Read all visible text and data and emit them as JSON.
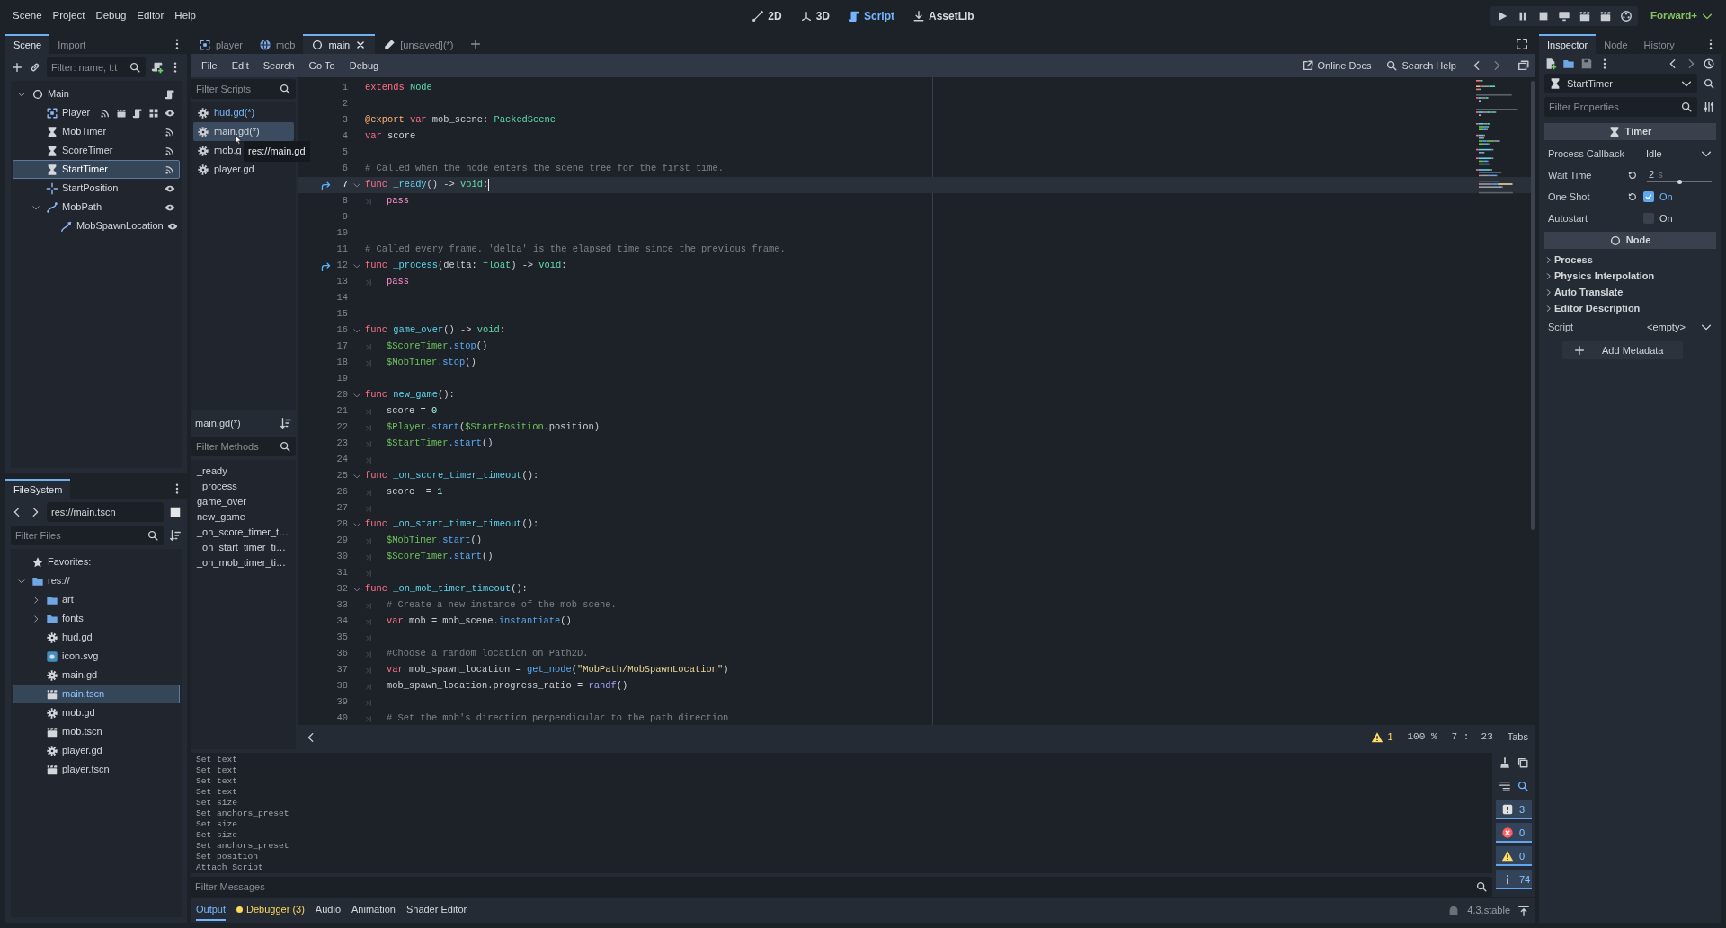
{
  "menu": [
    "Scene",
    "Project",
    "Debug",
    "Editor",
    "Help"
  ],
  "workspaces": [
    {
      "label": "2D",
      "kind": "vector",
      "selected": false
    },
    {
      "label": "3D",
      "kind": "axes",
      "selected": false
    },
    {
      "label": "Script",
      "kind": "script",
      "selected": true
    },
    {
      "label": "AssetLib",
      "kind": "download",
      "selected": false
    }
  ],
  "renderer": "Forward+",
  "scene_dock": {
    "tabs": [
      {
        "label": "Scene",
        "selected": true
      },
      {
        "label": "Import",
        "selected": false
      }
    ],
    "filter": {
      "placeholder": "Filter: name, t:t"
    },
    "tree": [
      {
        "label": "Main",
        "kind": "node",
        "selected": false,
        "expanded": true,
        "indicators": [
          {
            "kind": "script"
          }
        ],
        "children": [
          {
            "label": "Player",
            "kind": "area",
            "selected": false,
            "indicators": [
              {
                "kind": "signal"
              },
              {
                "kind": "scene"
              },
              {
                "kind": "script"
              },
              {
                "kind": "group"
              },
              {
                "kind": "eye"
              }
            ]
          },
          {
            "label": "MobTimer",
            "kind": "timer",
            "selected": false,
            "indicators": [
              {
                "kind": "signal"
              }
            ]
          },
          {
            "label": "ScoreTimer",
            "kind": "timer",
            "selected": false,
            "indicators": [
              {
                "kind": "signal"
              }
            ]
          },
          {
            "label": "StartTimer",
            "kind": "timer",
            "selected": true,
            "indicators": [
              {
                "kind": "signal"
              }
            ]
          },
          {
            "label": "StartPosition",
            "kind": "marker",
            "selected": false,
            "indicators": [
              {
                "kind": "eye"
              }
            ]
          },
          {
            "label": "MobPath",
            "kind": "path",
            "selected": false,
            "expanded": true,
            "indicators": [
              {
                "kind": "eye"
              }
            ],
            "children": [
              {
                "label": "MobSpawnLocation",
                "kind": "path_follow",
                "selected": false,
                "indicators": [
                  {
                    "kind": "eye"
                  }
                ]
              }
            ]
          }
        ]
      }
    ]
  },
  "filesystem": {
    "tab": "FileSystem",
    "path": "res://main.tscn",
    "filter": {
      "placeholder": "Filter Files"
    },
    "tree": [
      {
        "label": "Favorites:",
        "kind": "favorites",
        "selected": false
      },
      {
        "label": "res://",
        "kind": "folder",
        "selected": false,
        "expanded": true,
        "children": [
          {
            "label": "art",
            "kind": "folder",
            "selected": false,
            "expanded": false
          },
          {
            "label": "fonts",
            "kind": "folder",
            "selected": false,
            "expanded": false
          },
          {
            "label": "hud.gd",
            "kind": "script",
            "selected": false
          },
          {
            "label": "icon.svg",
            "kind": "image",
            "selected": false
          },
          {
            "label": "main.gd",
            "kind": "script",
            "selected": false
          },
          {
            "label": "main.tscn",
            "kind": "scene",
            "selected": true
          },
          {
            "label": "mob.gd",
            "kind": "script",
            "selected": false
          },
          {
            "label": "mob.tscn",
            "kind": "scene",
            "selected": false
          },
          {
            "label": "player.gd",
            "kind": "script",
            "selected": false
          },
          {
            "label": "player.tscn",
            "kind": "scene",
            "selected": false
          }
        ]
      }
    ]
  },
  "scene_tabs": [
    {
      "label": "player",
      "kind": "area",
      "selected": false
    },
    {
      "label": "mob",
      "kind": "globe",
      "selected": false
    },
    {
      "label": "main",
      "kind": "node",
      "selected": true
    },
    {
      "label": "[unsaved](*)",
      "kind": "pencil",
      "selected": false
    }
  ],
  "script_menu": [
    "File",
    "Edit",
    "Search",
    "Go To",
    "Debug"
  ],
  "help_links": [
    {
      "label": "Online Docs",
      "kind": "external"
    },
    {
      "label": "Search Help",
      "kind": "search"
    }
  ],
  "scripts": {
    "filter": {
      "placeholder": "Filter Scripts"
    },
    "items": [
      {
        "label": "hud.gd(*)",
        "selected": false,
        "highlighted": true
      },
      {
        "label": "main.gd(*)",
        "selected": true,
        "highlighted": false
      },
      {
        "label": "mob.g",
        "selected": false,
        "highlighted": false
      },
      {
        "label": "player.gd",
        "selected": false,
        "highlighted": false
      }
    ],
    "tooltip": "res://main.gd"
  },
  "methods": {
    "title": "main.gd(*)",
    "filter": {
      "placeholder": "Filter Methods"
    },
    "items": [
      "_ready",
      "_process",
      "game_over",
      "new_game",
      "_on_score_timer_t…",
      "_on_start_timer_ti…",
      "_on_mob_timer_ti…"
    ]
  },
  "editor": {
    "lines": [
      {
        "number": "1",
        "current": false,
        "foldable": false,
        "override": false,
        "indented": false,
        "tokens": [
          {
            "kind": "keyword",
            "text": "extends"
          },
          {
            "kind": "type",
            "text": " Node"
          }
        ]
      },
      {
        "number": "2",
        "current": false,
        "foldable": false,
        "override": false,
        "indented": false
      },
      {
        "number": "3",
        "current": false,
        "foldable": false,
        "override": false,
        "indented": false,
        "tokens": [
          {
            "kind": "annotation",
            "text": "@export"
          },
          {
            "kind": "keyword",
            "text": " var"
          },
          {
            "kind": "plain",
            "text": " mob_scene: "
          },
          {
            "kind": "type",
            "text": "PackedScene"
          }
        ]
      },
      {
        "number": "4",
        "current": false,
        "foldable": false,
        "override": false,
        "indented": false,
        "tokens": [
          {
            "kind": "keyword",
            "text": "var"
          },
          {
            "kind": "plain",
            "text": " score"
          }
        ]
      },
      {
        "number": "5",
        "current": false,
        "foldable": false,
        "override": false,
        "indented": false
      },
      {
        "number": "6",
        "current": false,
        "foldable": false,
        "override": false,
        "indented": false,
        "tokens": [
          {
            "kind": "comment",
            "text": "# Called when the node enters the scene tree for the first time."
          }
        ]
      },
      {
        "number": "7",
        "current": true,
        "foldable": true,
        "override": true,
        "indented": false,
        "tokens": [
          {
            "kind": "keyword",
            "text": "func"
          },
          {
            "kind": "name",
            "text": " _ready"
          },
          {
            "kind": "plain",
            "text": "() -> "
          },
          {
            "kind": "type",
            "text": "void"
          },
          {
            "kind": "plain",
            "text": ":"
          }
        ]
      },
      {
        "number": "8",
        "current": false,
        "foldable": false,
        "override": false,
        "indented": true,
        "tokens": [
          {
            "kind": "control",
            "text": "pass"
          }
        ]
      },
      {
        "number": "9",
        "current": false,
        "foldable": false,
        "override": false,
        "indented": false
      },
      {
        "number": "10",
        "current": false,
        "foldable": false,
        "override": false,
        "indented": false
      },
      {
        "number": "11",
        "current": false,
        "foldable": false,
        "override": false,
        "indented": false,
        "tokens": [
          {
            "kind": "comment",
            "text": "# Called every frame. 'delta' is the elapsed time since the previous frame."
          }
        ]
      },
      {
        "number": "12",
        "current": false,
        "foldable": true,
        "override": true,
        "indented": false,
        "tokens": [
          {
            "kind": "keyword",
            "text": "func"
          },
          {
            "kind": "name",
            "text": " _process"
          },
          {
            "kind": "plain",
            "text": "(delta: "
          },
          {
            "kind": "type",
            "text": "float"
          },
          {
            "kind": "plain",
            "text": ") -> "
          },
          {
            "kind": "type",
            "text": "void"
          },
          {
            "kind": "plain",
            "text": ":"
          }
        ]
      },
      {
        "number": "13",
        "current": false,
        "foldable": false,
        "override": false,
        "indented": true,
        "tokens": [
          {
            "kind": "control",
            "text": "pass"
          }
        ]
      },
      {
        "number": "14",
        "current": false,
        "foldable": false,
        "override": false,
        "indented": false
      },
      {
        "number": "15",
        "current": false,
        "foldable": false,
        "override": false,
        "indented": false
      },
      {
        "number": "16",
        "current": false,
        "foldable": true,
        "override": false,
        "indented": false,
        "tokens": [
          {
            "kind": "keyword",
            "text": "func"
          },
          {
            "kind": "name",
            "text": " game_over"
          },
          {
            "kind": "plain",
            "text": "() -> "
          },
          {
            "kind": "type",
            "text": "void"
          },
          {
            "kind": "plain",
            "text": ":"
          }
        ]
      },
      {
        "number": "17",
        "current": false,
        "foldable": false,
        "override": false,
        "indented": true,
        "tokens": [
          {
            "kind": "node",
            "text": "$ScoreTimer"
          },
          {
            "kind": "method",
            "text": ".stop"
          },
          {
            "kind": "plain",
            "text": "()"
          }
        ]
      },
      {
        "number": "18",
        "current": false,
        "foldable": false,
        "override": false,
        "indented": true,
        "tokens": [
          {
            "kind": "node",
            "text": "$MobTimer"
          },
          {
            "kind": "method",
            "text": ".stop"
          },
          {
            "kind": "plain",
            "text": "()"
          }
        ]
      },
      {
        "number": "19",
        "current": false,
        "foldable": false,
        "override": false,
        "indented": false
      },
      {
        "number": "20",
        "current": false,
        "foldable": true,
        "override": false,
        "indented": false,
        "tokens": [
          {
            "kind": "keyword",
            "text": "func"
          },
          {
            "kind": "name",
            "text": " new_game"
          },
          {
            "kind": "plain",
            "text": "():"
          }
        ]
      },
      {
        "number": "21",
        "current": false,
        "foldable": false,
        "override": false,
        "indented": true,
        "tokens": [
          {
            "kind": "plain",
            "text": "score = "
          },
          {
            "kind": "number",
            "text": "0"
          }
        ]
      },
      {
        "number": "22",
        "current": false,
        "foldable": false,
        "override": false,
        "indented": true,
        "tokens": [
          {
            "kind": "node",
            "text": "$Player"
          },
          {
            "kind": "method",
            "text": ".start"
          },
          {
            "kind": "plain",
            "text": "("
          },
          {
            "kind": "node",
            "text": "$StartPosition"
          },
          {
            "kind": "plain",
            "text": ".position)"
          }
        ]
      },
      {
        "number": "23",
        "current": false,
        "foldable": false,
        "override": false,
        "indented": true,
        "tokens": [
          {
            "kind": "node",
            "text": "$StartTimer"
          },
          {
            "kind": "method",
            "text": ".start"
          },
          {
            "kind": "plain",
            "text": "()"
          }
        ]
      },
      {
        "number": "24",
        "current": false,
        "foldable": false,
        "override": false,
        "indented": true
      },
      {
        "number": "25",
        "current": false,
        "foldable": true,
        "override": false,
        "indented": false,
        "tokens": [
          {
            "kind": "keyword",
            "text": "func"
          },
          {
            "kind": "name",
            "text": " _on_score_timer_timeout"
          },
          {
            "kind": "plain",
            "text": "():"
          }
        ]
      },
      {
        "number": "26",
        "current": false,
        "foldable": false,
        "override": false,
        "indented": true,
        "tokens": [
          {
            "kind": "plain",
            "text": "score += "
          },
          {
            "kind": "number",
            "text": "1"
          }
        ]
      },
      {
        "number": "27",
        "current": false,
        "foldable": false,
        "override": false,
        "indented": true
      },
      {
        "number": "28",
        "current": false,
        "foldable": true,
        "override": false,
        "indented": false,
        "tokens": [
          {
            "kind": "keyword",
            "text": "func"
          },
          {
            "kind": "name",
            "text": " _on_start_timer_timeout"
          },
          {
            "kind": "plain",
            "text": "():"
          }
        ]
      },
      {
        "number": "29",
        "current": false,
        "foldable": false,
        "override": false,
        "indented": true,
        "tokens": [
          {
            "kind": "node",
            "text": "$MobTimer"
          },
          {
            "kind": "method",
            "text": ".start"
          },
          {
            "kind": "plain",
            "text": "()"
          }
        ]
      },
      {
        "number": "30",
        "current": false,
        "foldable": false,
        "override": false,
        "indented": true,
        "tokens": [
          {
            "kind": "node",
            "text": "$ScoreTimer"
          },
          {
            "kind": "method",
            "text": ".start"
          },
          {
            "kind": "plain",
            "text": "()"
          }
        ]
      },
      {
        "number": "31",
        "current": false,
        "foldable": false,
        "override": false,
        "indented": true
      },
      {
        "number": "32",
        "current": false,
        "foldable": true,
        "override": false,
        "indented": false,
        "tokens": [
          {
            "kind": "keyword",
            "text": "func"
          },
          {
            "kind": "name",
            "text": " _on_mob_timer_timeout"
          },
          {
            "kind": "plain",
            "text": "():"
          }
        ]
      },
      {
        "number": "33",
        "current": false,
        "foldable": false,
        "override": false,
        "indented": true,
        "tokens": [
          {
            "kind": "comment",
            "text": "# Create a new instance of the mob scene."
          }
        ]
      },
      {
        "number": "34",
        "current": false,
        "foldable": false,
        "override": false,
        "indented": true,
        "tokens": [
          {
            "kind": "keyword",
            "text": "var"
          },
          {
            "kind": "plain",
            "text": " mob = mob_scene"
          },
          {
            "kind": "method",
            "text": ".instantiate"
          },
          {
            "kind": "plain",
            "text": "()"
          }
        ]
      },
      {
        "number": "35",
        "current": false,
        "foldable": false,
        "override": false,
        "indented": true
      },
      {
        "number": "36",
        "current": false,
        "foldable": false,
        "override": false,
        "indented": true,
        "tokens": [
          {
            "kind": "comment",
            "text": "#Choose a random location on Path2D."
          }
        ]
      },
      {
        "number": "37",
        "current": false,
        "foldable": false,
        "override": false,
        "indented": true,
        "tokens": [
          {
            "kind": "keyword",
            "text": "var"
          },
          {
            "kind": "plain",
            "text": " mob_spawn_location = "
          },
          {
            "kind": "method",
            "text": "get_node"
          },
          {
            "kind": "plain",
            "text": "("
          },
          {
            "kind": "string",
            "text": "\"MobPath/MobSpawnLocation\""
          },
          {
            "kind": "plain",
            "text": ")"
          }
        ]
      },
      {
        "number": "38",
        "current": false,
        "foldable": false,
        "override": false,
        "indented": true,
        "tokens": [
          {
            "kind": "plain",
            "text": "mob_spawn_location.progress_ratio = "
          },
          {
            "kind": "builtin",
            "text": "randf"
          },
          {
            "kind": "plain",
            "text": "()"
          }
        ]
      },
      {
        "number": "39",
        "current": false,
        "foldable": false,
        "override": false,
        "indented": true
      },
      {
        "number": "40",
        "current": false,
        "foldable": false,
        "override": false,
        "indented": true,
        "tokens": [
          {
            "kind": "comment",
            "text": "# Set the mob's direction perpendicular to the path direction"
          }
        ]
      }
    ]
  },
  "status": {
    "warnings": "1",
    "zoom": "100 %",
    "position": "7 :  23",
    "indent": "Tabs"
  },
  "output": {
    "lines": [
      "Set text",
      "Set text",
      "Set text",
      "Set text",
      "Set size",
      "Set anchors_preset",
      "Set size",
      "Set size",
      "Set anchors_preset",
      "Set position",
      "Attach Script"
    ],
    "filter": {
      "placeholder": "Filter Messages"
    },
    "counters": [
      {
        "kind": "message",
        "count": "3",
        "on": true
      },
      {
        "kind": "error",
        "count": "0",
        "on": true
      },
      {
        "kind": "warning",
        "count": "0",
        "on": true
      },
      {
        "kind": "info",
        "count": "74",
        "on": true
      }
    ]
  },
  "bottom_tabs": [
    {
      "label": "Output",
      "selected": true,
      "alert": false
    },
    {
      "label": "Debugger (3)",
      "selected": false,
      "alert": true
    },
    {
      "label": "Audio",
      "selected": false,
      "alert": false
    },
    {
      "label": "Animation",
      "selected": false,
      "alert": false
    },
    {
      "label": "Shader Editor",
      "selected": false,
      "alert": false
    }
  ],
  "version": "4.3.stable",
  "inspector": {
    "tabs": [
      {
        "label": "Inspector",
        "selected": true
      },
      {
        "label": "Node",
        "selected": false
      },
      {
        "label": "History",
        "selected": false
      }
    ],
    "object": {
      "label": "StartTimer",
      "kind": "timer"
    },
    "filter": {
      "placeholder": "Filter Properties"
    },
    "sections": [
      {
        "title": "Timer",
        "kind": "timer",
        "properties": [
          {
            "label": "Process Callback",
            "kind": "select",
            "value": "Idle",
            "revert": false
          },
          {
            "label": "Wait Time",
            "kind": "range",
            "value": "2",
            "unit": "s",
            "level": 0.5,
            "revert": true
          },
          {
            "label": "One Shot",
            "kind": "check",
            "checked": true,
            "text": "On",
            "revert": true
          },
          {
            "label": "Autostart",
            "kind": "check",
            "checked": false,
            "text": "On",
            "revert": false
          }
        ]
      },
      {
        "title": "Node",
        "kind": "node"
      }
    ],
    "groups": [
      {
        "label": "Process",
        "expanded": false
      },
      {
        "label": "Physics Interpolation",
        "expanded": false
      },
      {
        "label": "Auto Translate",
        "expanded": false
      },
      {
        "label": "Editor Description",
        "expanded": false
      }
    ],
    "script": {
      "label": "Script",
      "value": "<empty>"
    },
    "add_button": "Add Metadata"
  }
}
